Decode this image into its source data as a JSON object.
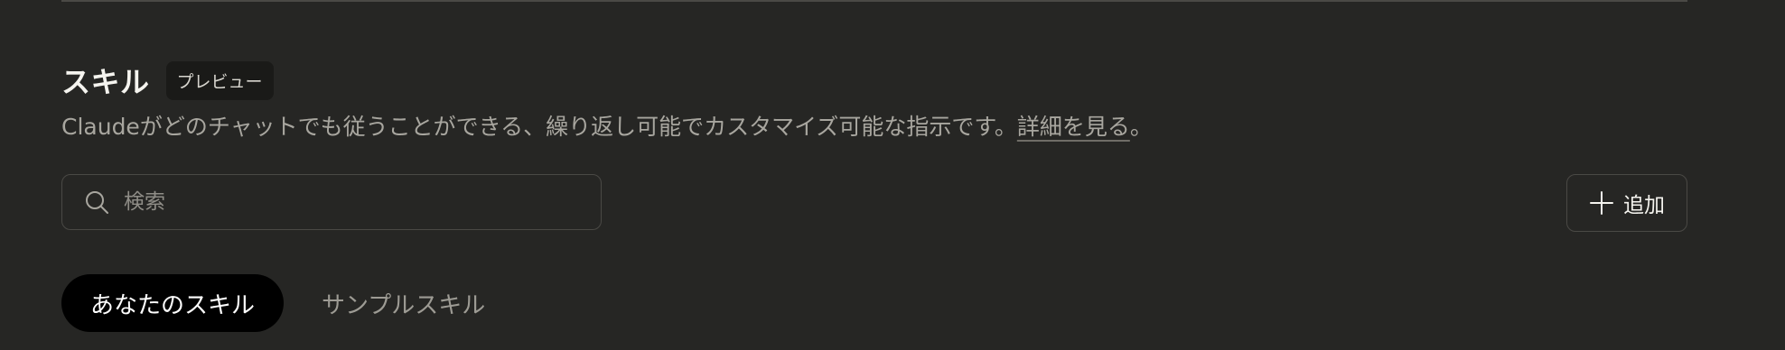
{
  "section": {
    "title": "スキル",
    "badge": "プレビュー",
    "description": "Claudeがどのチャットでも従うことができる、繰り返し可能でカスタマイズ可能な指示です。",
    "learn_more": "詳細を見る",
    "desc_end": "。"
  },
  "search": {
    "placeholder": "検索",
    "value": ""
  },
  "add_button": {
    "label": "追加"
  },
  "tabs": [
    {
      "label": "あなたのスキル",
      "active": true
    },
    {
      "label": "サンプルスキル",
      "active": false
    }
  ],
  "colors": {
    "background": "#262624",
    "active_tab_bg": "#000000",
    "border": "#4a4945"
  }
}
